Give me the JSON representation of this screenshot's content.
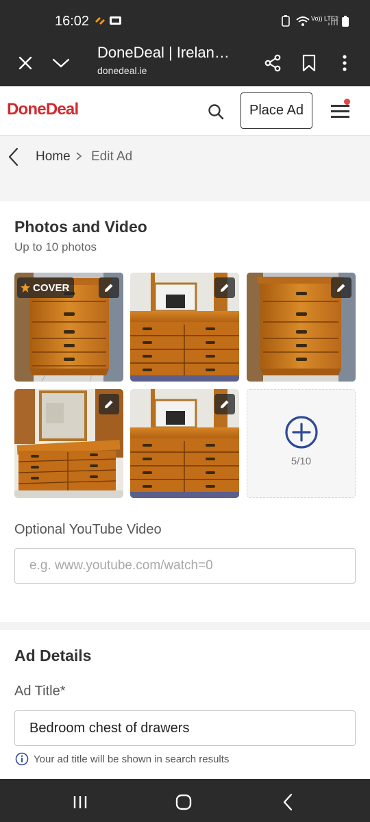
{
  "status_bar": {
    "time": "16:02",
    "network_label": "Vo)) LTE2"
  },
  "browser": {
    "title": "DoneDeal | Ireland's Largest Marketplace",
    "url": "donedeal.ie",
    "icons": [
      "close-icon",
      "chevron-down-icon",
      "share-icon",
      "bookmark-icon",
      "more-vertical-icon"
    ]
  },
  "header": {
    "logo_done": "Done",
    "logo_deal": "Deal",
    "place_ad_label": "Place Ad",
    "accent_color": "#d3292e"
  },
  "breadcrumb": {
    "home": "Home",
    "current": "Edit Ad"
  },
  "photos": {
    "title": "Photos and Video",
    "subtitle": "Up to 10 photos",
    "cover_label": "COVER",
    "count_label": "5/10",
    "images": [
      {
        "subject": "tall chest of drawers",
        "cover": true
      },
      {
        "subject": "long dresser with mirror (close)",
        "cover": false
      },
      {
        "subject": "tall chest of drawers",
        "cover": false
      },
      {
        "subject": "long dresser with mirror (room view)",
        "cover": false
      },
      {
        "subject": "long dresser with mirror (close)",
        "cover": false
      }
    ]
  },
  "youtube": {
    "label": "Optional YouTube Video",
    "placeholder": "e.g. www.youtube.com/watch=0",
    "value": ""
  },
  "ad_details": {
    "title": "Ad Details",
    "ad_title_label": "Ad Title*",
    "ad_title_value": "Bedroom chest of drawers",
    "hint": "Your ad title will be shown in search results"
  },
  "colors": {
    "link_blue": "#2d4a9a",
    "wood": "#c97a1e"
  }
}
